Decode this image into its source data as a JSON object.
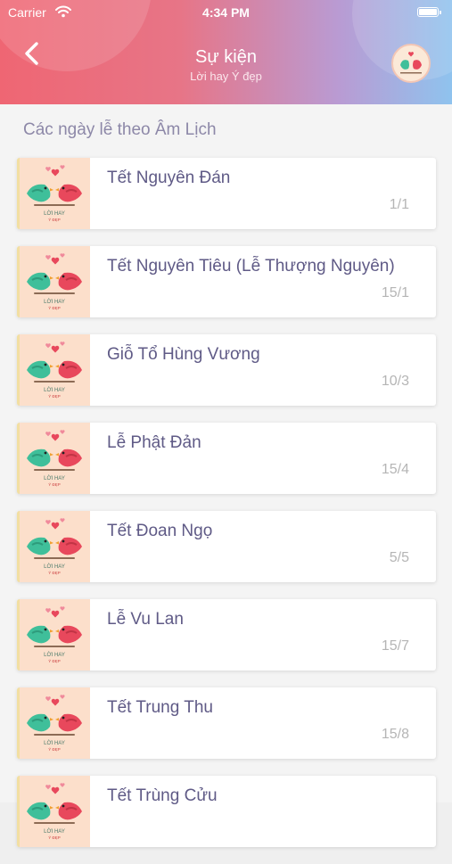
{
  "status_bar": {
    "carrier": "Carrier",
    "time": "4:34 PM"
  },
  "header": {
    "title": "Sự kiện",
    "subtitle": "Lời hay Ý đẹp",
    "back_icon": "chevron-left-icon",
    "avatar_icon": "love-birds-icon"
  },
  "section_title": "Các ngày lễ theo Âm Lịch",
  "thumb_caption": {
    "line1": "LỜI HAY",
    "line2": "Ý ĐẸP"
  },
  "events": [
    {
      "name": "Tết Nguyên Đán",
      "date": "1/1"
    },
    {
      "name": "Tết Nguyên Tiêu (Lễ Thượng Nguyên)",
      "date": "15/1"
    },
    {
      "name": "Giỗ Tổ Hùng Vương",
      "date": "10/3"
    },
    {
      "name": "Lễ Phật Đản",
      "date": "15/4"
    },
    {
      "name": "Tết Đoan Ngọ",
      "date": "5/5"
    },
    {
      "name": "Lễ Vu Lan",
      "date": "15/7"
    },
    {
      "name": "Tết Trung Thu",
      "date": "15/8"
    },
    {
      "name": "Tết Trùng Cửu",
      "date": ""
    }
  ],
  "colors": {
    "header_start": "#ef6673",
    "header_end": "#8fc3ee",
    "title_text": "#5f5a86",
    "section_text": "#8d88a8",
    "date_text": "#b5b5b5",
    "thumb_bg": "#fcdfcb"
  }
}
